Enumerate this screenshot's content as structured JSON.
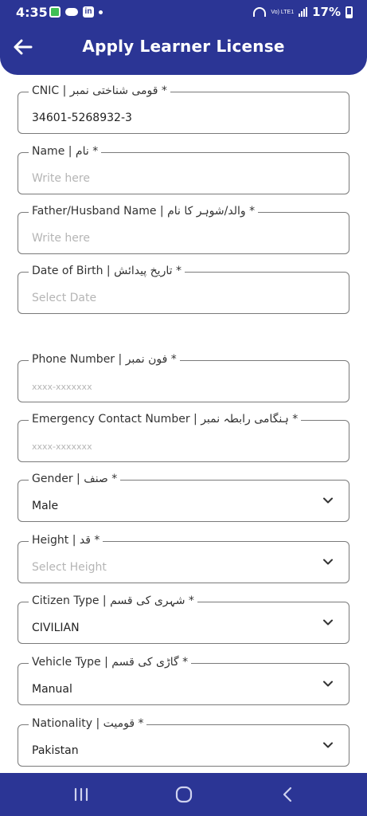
{
  "status_bar": {
    "time": "4:35",
    "notification_icons": [
      "app-icon",
      "cloud-icon",
      "linkedin-icon"
    ],
    "battery": "17%",
    "network": "Vo) LTE1"
  },
  "header": {
    "title": "Apply Learner License",
    "back_icon": "back-arrow-icon",
    "background_color": "#2b3595"
  },
  "form": {
    "cnic": {
      "label": "CNIC | قومی شناختی نمبر *",
      "value": "34601-5268932-3"
    },
    "name": {
      "label": "Name | نام *",
      "placeholder": "Write here"
    },
    "father_name": {
      "label": "Father/Husband Name | والد/شوہر کا نام *",
      "placeholder": "Write here"
    },
    "dob": {
      "label": "Date of Birth | تاریخ پیدائش *",
      "placeholder": "Select Date"
    },
    "phone": {
      "label": "Phone Number | فون نمبر *",
      "placeholder": "xxxx-xxxxxxx"
    },
    "emergency": {
      "label": "Emergency Contact Number | ہنگامی رابطہ نمبر *",
      "placeholder": "xxxx-xxxxxxx"
    },
    "gender": {
      "label": "Gender | صنف *",
      "value": "Male"
    },
    "height": {
      "label": "Height | قد *",
      "placeholder": "Select Height"
    },
    "citizen_type": {
      "label": "Citizen Type | شہری کی قسم *",
      "value": "CIVILIAN"
    },
    "vehicle_type": {
      "label": "Vehicle Type | گاڑی کی قسم *",
      "value": "Manual"
    },
    "nationality": {
      "label": "Nationality | قومیت *",
      "value": "Pakistan"
    }
  },
  "nav_bar": {
    "buttons": [
      "recent-apps-icon",
      "home-icon",
      "back-icon"
    ]
  }
}
